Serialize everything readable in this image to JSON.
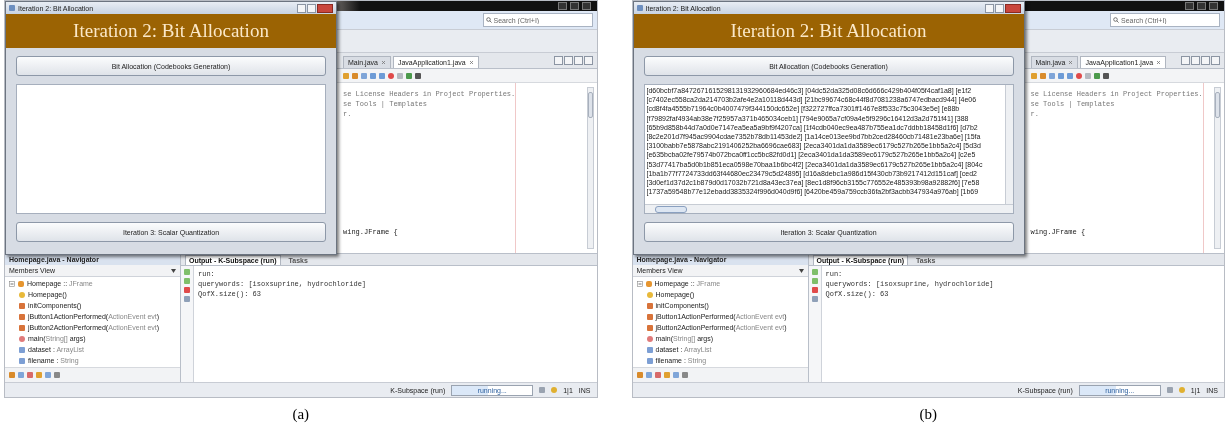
{
  "panels": [
    {
      "caption": "(a)",
      "dialog": {
        "window_title": "Iteration 2: Bit Allocation",
        "heading": "Iteration 2: Bit Allocation",
        "buttons": [
          "Bit Allocation (Codebooks Generation)",
          "Iteration 3: Scalar Quantization"
        ]
      },
      "ide": {
        "search_placeholder": "Search (Ctrl+I)",
        "editor_tabs": [
          {
            "label": "Main.java",
            "selected": false
          },
          {
            "label": "JavaApplication1.java",
            "selected": true
          }
        ],
        "comment_lines": [
          "se License Headers in Project Properties.",
          "se Tools | Templates",
          "r."
        ],
        "class_line": "wing.JFrame {",
        "navigator_title": "Homepage.java - Navigator",
        "members_view": "Members View",
        "tree": [
          {
            "label": "Homepage :: ",
            "detail": "JFrame",
            "kind": "class",
            "expanded": true,
            "children": [
              {
                "label": "Homepage()",
                "kind": "constructor"
              },
              {
                "label": "initComponents()",
                "kind": "method"
              },
              {
                "label": "jButton1ActionPerformed(",
                "detail": "ActionEvent evt",
                "tail": ")",
                "kind": "method"
              },
              {
                "label": "jButton2ActionPerformed(",
                "detail": "ActionEvent evt",
                "tail": ")",
                "kind": "method"
              },
              {
                "label": "main(",
                "detail": "String[]",
                "tail": " args)",
                "kind": "static"
              },
              {
                "label": "dataset : ",
                "detail": "ArrayList",
                "kind": "field"
              },
              {
                "label": "filename : ",
                "detail": "String",
                "kind": "field"
              }
            ]
          }
        ],
        "output_tabs": [
          {
            "label": "Output - K-Subspace (run)",
            "selected": true
          },
          {
            "label": "Tasks",
            "selected": false
          }
        ],
        "output_lines": [
          "run:",
          "querywords: [isoxsuprine, hydrochloride]",
          "QofX.size(): 63"
        ],
        "status": {
          "task": "K-Subspace (run)",
          "progress_label": "running...",
          "level": 0.45,
          "position": "1|1",
          "mode": "INS"
        }
      }
    },
    {
      "caption": "(b)",
      "dialog": {
        "window_title": "Iteration 2: Bit Allocation",
        "heading": "Iteration 2: Bit Allocation",
        "buttons": [
          "Bit Allocation (Codebooks Generation)",
          "Iteration 3: Scalar Quantization"
        ],
        "output_lines": [
          "[d60bcbf7a8472671615298131932960684ed46c3] [04dc52da325d08c6d666c429b404f05f4caf1a8] [e1f2",
          "[c7402ec558ca2da214703b2afe4e2a10118d443d] [21bc99674c68c44f8d7081238a6747edbacd944] [4e06",
          "[cd8f4fa4555b71964c0b4007479f344150dc652e] [f322727ffca7301ff1467e8f533c75c3043e5e] [e88b",
          "[f79892faf4934ab38e7f25957a371b465034ceb1] [794e9065a7cf09a4e5f9296c16412d3a2d751f41] [388",
          "[65b9d858b44d7a0d0e7147ea5ea5a9bf9f4207ca] [1f4cdb040ec9ea487b755ea1dc7ddbb18458d1f6] [d7b2",
          "[8c2e201d7f945ac9904cdae7352b78db11453de2] [1a14ce013ee9bd7bb2ced28460cb71481e23ba6e] [15fa",
          "[3100babb7e5878abc2191406252ba6696cae683] [2eca3401da1da3589ec6179c527b265e1bb5a2c4] [5d3d",
          "[e635bcba02fe79574b072bca0ff1cc5bc82fd0d1] [2eca3401da1da3589ec6179c527b265e1bb5a2c4] [c2e5",
          "[53d77417ba5d0b1b851eca0598e70baa1b6bc4f2] [2eca3401da1da3589ec6179c527b265e1bb5a2c4] [804c",
          "[1ba1b77f7724733dd63f44680ec23479c5d24895] [d16a8debc1a986d15f430cb73b9217412d151caf] [ced2",
          "[3d0ef1d37d2c1b879d0d17032b721d8a43ec37ea] [8ec1d8f96cb3155c776552e485393b98a92882f6] [7e58",
          "[1737a59548b77e12ebadd3835324f996d040d9f6] [6420be459a759ccb36fa2bf3acbb347934a976ab] [1b69"
        ]
      },
      "ide": {
        "search_placeholder": "Search (Ctrl+I)",
        "editor_tabs": [
          {
            "label": "Main.java",
            "selected": false
          },
          {
            "label": "JavaApplication1.java",
            "selected": true
          }
        ],
        "comment_lines": [
          "se License Headers in Project Properties.",
          "se Tools | Templates",
          "r."
        ],
        "class_line": "wing.JFrame {",
        "navigator_title": "Homepage.java - Navigator",
        "members_view": "Members View",
        "tree": [
          {
            "label": "Homepage :: ",
            "detail": "JFrame",
            "kind": "class",
            "expanded": true,
            "children": [
              {
                "label": "Homepage()",
                "kind": "constructor"
              },
              {
                "label": "initComponents()",
                "kind": "method"
              },
              {
                "label": "jButton1ActionPerformed(",
                "detail": "ActionEvent evt",
                "tail": ")",
                "kind": "method"
              },
              {
                "label": "jButton2ActionPerformed(",
                "detail": "ActionEvent evt",
                "tail": ")",
                "kind": "method"
              },
              {
                "label": "main(",
                "detail": "String[]",
                "tail": " args)",
                "kind": "static"
              },
              {
                "label": "dataset : ",
                "detail": "ArrayList",
                "kind": "field"
              },
              {
                "label": "filename : ",
                "detail": "String",
                "kind": "field"
              }
            ]
          }
        ],
        "output_tabs": [
          {
            "label": "Output - K-Subspace (run)",
            "selected": true
          },
          {
            "label": "Tasks",
            "selected": false
          }
        ],
        "output_lines": [
          "run:",
          "querywords: [isoxsuprine, hydrochloride]",
          "QofX.size(): 63"
        ],
        "status": {
          "task": "K-Subspace (run)",
          "progress_label": "running...",
          "level": 0.45,
          "position": "1|1",
          "mode": "INS"
        }
      }
    }
  ]
}
